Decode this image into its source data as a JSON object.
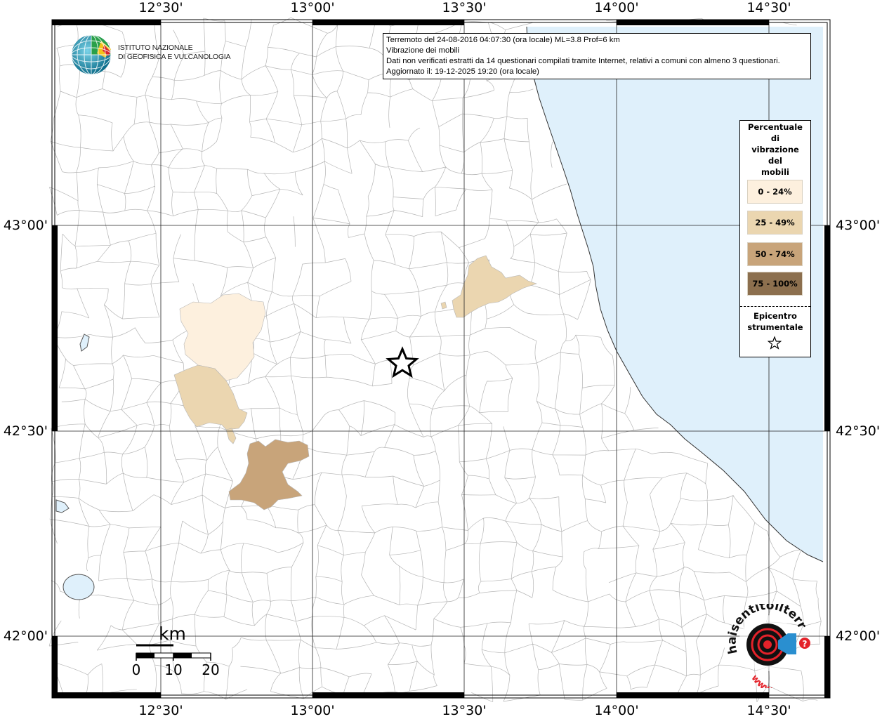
{
  "map": {
    "lon_ticks": [
      "12°30'",
      "13°00'",
      "13°30'",
      "14°00'",
      "14°30'"
    ],
    "lat_ticks": [
      "43°00'",
      "42°30'",
      "42°00'"
    ],
    "colors": {
      "sea": "#dff0fb",
      "class_0_24": "#fdf0de",
      "class_25_49": "#ebd6b0",
      "class_50_74": "#c8a47a",
      "class_75_100": "#8c6f4e",
      "boundaries": "#b5b5b5",
      "frame": "#000000"
    }
  },
  "info": {
    "line1": "Terremoto del 24-08-2016 04:07:30 (ora locale) ML=3.8 Prof=6 km",
    "line2": "Vibrazione dei mobili",
    "line3": "Dati non verificati estratti da 14 questionari compilati tramite Internet, relativi a comuni con almeno 3 questionari.",
    "line4": "Aggiornato il: 19-12-2025 19:20 (ora locale)"
  },
  "legend": {
    "title": "Percentuale\ndi\nvibrazione\ndel\nmobili",
    "items": [
      {
        "label": "0 - 24%",
        "color": "#fdf0de"
      },
      {
        "label": "25 - 49%",
        "color": "#ebd6b0"
      },
      {
        "label": "50 - 74%",
        "color": "#c8a47a"
      },
      {
        "label": "75 - 100%",
        "color": "#8c6f4e"
      }
    ],
    "epicenter_label": "Epicentro\nstrumentale",
    "epicenter_icon": "star-icon"
  },
  "logo": {
    "line1": "ISTITUTO NAZIONALE",
    "line2": "DI GEOFISICA E VULCANOLOGIA",
    "icon": "ingv-globe-icon"
  },
  "scale": {
    "unit": "km",
    "labels": [
      "0",
      "10",
      "20"
    ]
  },
  "hst": {
    "text_main": "haisentitoilterremoto",
    "text_accent": ".it",
    "text_www": "www.",
    "icon": "hai-sentito-il-terremoto-logo"
  }
}
